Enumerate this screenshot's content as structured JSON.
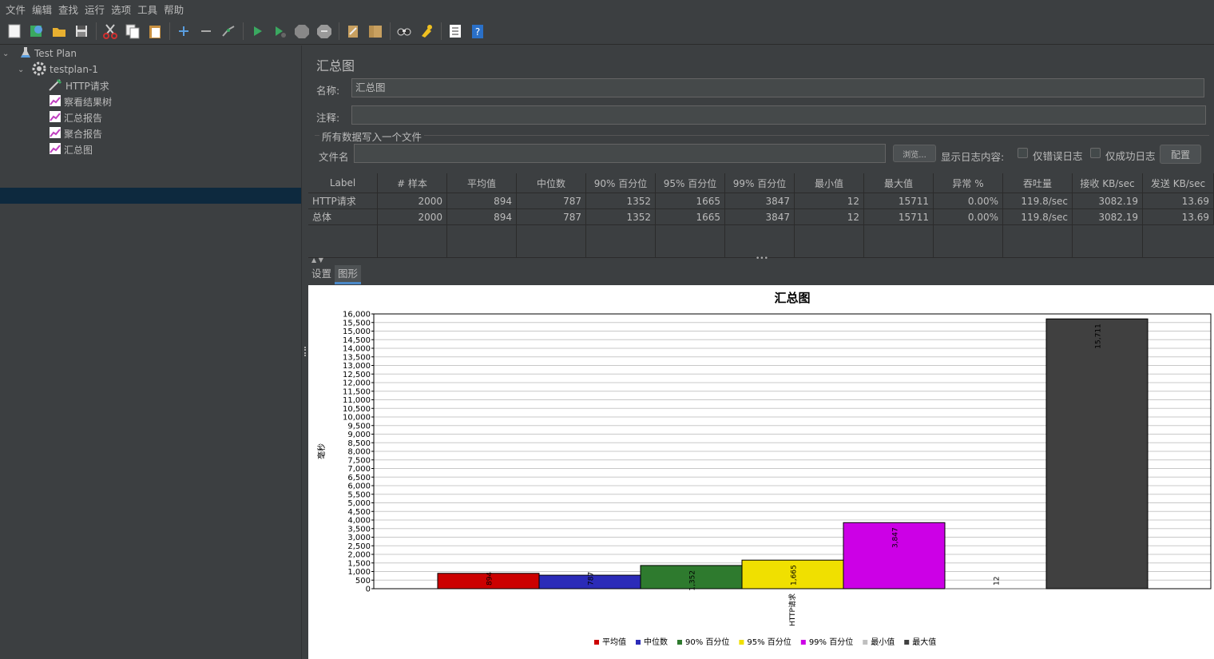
{
  "menu": [
    "文件",
    "编辑",
    "查找",
    "运行",
    "选项",
    "工具",
    "帮助"
  ],
  "toolbar_icons": [
    "new-icon",
    "templates-icon",
    "open-icon",
    "save-icon",
    "cut-icon",
    "copy-icon",
    "paste-icon",
    "expand-icon",
    "collapse-icon",
    "toggle-icon",
    "start-icon",
    "start-no-pause-icon",
    "stop-icon",
    "shutdown-icon",
    "clear-icon",
    "clear-all-icon",
    "search-icon",
    "reset-search-icon",
    "function-helper-icon",
    "help-icon"
  ],
  "tree": {
    "items": [
      {
        "label": "Test Plan",
        "icon": "flask-icon"
      },
      {
        "label": "testplan-1",
        "icon": "gear-icon"
      },
      {
        "label": "HTTP请求",
        "icon": "pipette-icon"
      },
      {
        "label": "察看结果树",
        "icon": "graph-icon"
      },
      {
        "label": "汇总报告",
        "icon": "graph-icon"
      },
      {
        "label": "聚合报告",
        "icon": "graph-icon"
      },
      {
        "label": "汇总图",
        "icon": "graph-icon"
      }
    ]
  },
  "panel": {
    "title": "汇总图",
    "name_label": "名称:",
    "name_value": "汇总图",
    "comment_label": "注释:",
    "comment_value": "",
    "group_title": "所有数据写入一个文件",
    "filename_label": "文件名",
    "filename_value": "",
    "browse_button": "浏览...",
    "log_label": "显示日志内容:",
    "errors_only": "仅错误日志",
    "success_only": "仅成功日志",
    "configure_button": "配置"
  },
  "table": {
    "headers": [
      "Label",
      "# 样本",
      "平均值",
      "中位数",
      "90% 百分位",
      "95% 百分位",
      "99% 百分位",
      "最小值",
      "最大值",
      "异常 %",
      "吞吐量",
      "接收 KB/sec",
      "发送 KB/sec"
    ],
    "rows": [
      [
        "HTTP请求",
        "2000",
        "894",
        "787",
        "1352",
        "1665",
        "3847",
        "12",
        "15711",
        "0.00%",
        "119.8/sec",
        "3082.19",
        "13.69"
      ],
      [
        "总体",
        "2000",
        "894",
        "787",
        "1352",
        "1665",
        "3847",
        "12",
        "15711",
        "0.00%",
        "119.8/sec",
        "3082.19",
        "13.69"
      ]
    ]
  },
  "tabs": [
    "设置",
    "图形"
  ],
  "chart_data": {
    "type": "bar",
    "title": "汇总图",
    "ylabel": "毫秒",
    "xlabel": "",
    "categories": [
      "HTTP请求"
    ],
    "ylim": [
      0,
      16000
    ],
    "ytick_step": 500,
    "grid": true,
    "legend_position": "bottom",
    "series": [
      {
        "name": "平均值",
        "values": [
          894
        ],
        "label": "894",
        "color": "#cc0000"
      },
      {
        "name": "中位数",
        "values": [
          787
        ],
        "label": "787",
        "color": "#2b2bb8"
      },
      {
        "name": "90% 百分位",
        "values": [
          1352
        ],
        "label": "1,352",
        "color": "#2e7a2e"
      },
      {
        "name": "95% 百分位",
        "values": [
          1665
        ],
        "label": "1,665",
        "color": "#f0e000"
      },
      {
        "name": "99% 百分位",
        "values": [
          3847
        ],
        "label": "3,847",
        "color": "#cc00e6"
      },
      {
        "name": "最小值",
        "values": [
          12
        ],
        "label": "12",
        "color": "#c0c0c0"
      },
      {
        "name": "最大值",
        "values": [
          15711
        ],
        "label": "15,711",
        "color": "#404040"
      }
    ]
  }
}
